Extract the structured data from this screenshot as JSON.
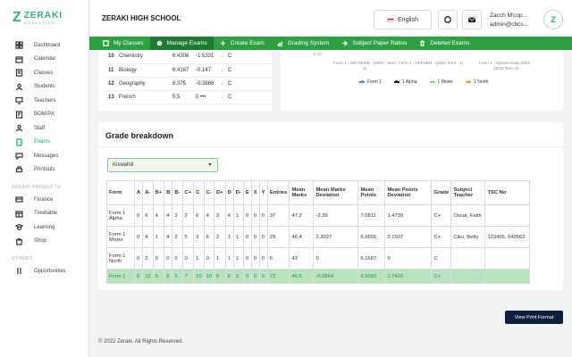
{
  "brand": {
    "name": "ZERAKI",
    "tagline": "ANALYTICS"
  },
  "sidebar": {
    "items": [
      {
        "label": "Dashboard",
        "icon": "dashboard-icon"
      },
      {
        "label": "Calendar",
        "icon": "calendar-icon"
      },
      {
        "label": "Classes",
        "icon": "classes-icon"
      },
      {
        "label": "Students",
        "icon": "students-icon"
      },
      {
        "label": "Teachers",
        "icon": "teachers-icon"
      },
      {
        "label": "BOM/PA",
        "icon": "bom-icon"
      },
      {
        "label": "Staff",
        "icon": "staff-icon"
      },
      {
        "label": "Exams",
        "icon": "exams-icon",
        "active": true
      },
      {
        "label": "Messages",
        "icon": "messages-icon"
      },
      {
        "label": "Printouts",
        "icon": "printouts-icon"
      }
    ],
    "products_heading": "ZERAKI PRODUCTS",
    "products": [
      {
        "label": "Finance",
        "icon": "finance-icon"
      },
      {
        "label": "Timetable",
        "icon": "timetable-icon"
      },
      {
        "label": "Learning",
        "icon": "learning-icon"
      },
      {
        "label": "Shop",
        "icon": "shop-icon"
      }
    ],
    "others_heading": "OTHERS",
    "others": [
      {
        "label": "Opportunities",
        "icon": "opportunities-icon"
      }
    ]
  },
  "header": {
    "school": "ZERAKI HIGH SCHOOL",
    "language": "English",
    "user_name": "Zacch M'cop...",
    "user_email": "admin@cbcs..."
  },
  "tabs": [
    {
      "label": "My Classes",
      "icon": "classes-tab-icon"
    },
    {
      "label": "Manage Exams",
      "icon": "gear-icon",
      "active": true
    },
    {
      "label": "Create Exam",
      "icon": "plus-icon"
    },
    {
      "label": "Grading System",
      "icon": "chart-icon"
    },
    {
      "label": "Subject Paper Ratios",
      "icon": "ratio-icon"
    },
    {
      "label": "Deleted Exams",
      "icon": "trash-icon"
    }
  ],
  "subjects": [
    {
      "no": "10",
      "name": "Chemistry",
      "mean": "6.4306",
      "dev": "-1.5331",
      "grade": "C"
    },
    {
      "no": "11",
      "name": "Biology",
      "mean": "6.4167",
      "dev": "-0.147",
      "grade": "C"
    },
    {
      "no": "12",
      "name": "Geography",
      "mean": "6.375",
      "dev": "-0.3886",
      "grade": "C"
    },
    {
      "no": "13",
      "name": "French",
      "mean": "5.5",
      "dev": "0 •••",
      "grade": "C"
    }
  ],
  "chart": {
    "tick": "6.25",
    "categories": [
      "Form 1 - MID TERM - (2022 - Term 1)",
      "Form 1 - OPENER - (2022 Term - 1)",
      "Form 1 - Opener exam 2022 - (2022 Term 1)"
    ],
    "legend": [
      {
        "name": "Form 1",
        "color": "#4a90e2"
      },
      {
        "name": "1 Alpha",
        "color": "#222222"
      },
      {
        "name": "1 Moxie",
        "color": "#8bdc8b"
      },
      {
        "name": "1 North",
        "color": "#f0a030"
      }
    ]
  },
  "grade_breakdown": {
    "title": "Grade breakdown",
    "selected_subject": "Kiswahili",
    "headers": [
      "Form",
      "A",
      "A-",
      "B+",
      "B",
      "B-",
      "C+",
      "C",
      "C-",
      "D+",
      "D",
      "D-",
      "E",
      "X",
      "Y",
      "Entries",
      "Mean Marks",
      "Mean Marks Deviation",
      "Mean Points",
      "Mean Points Deviation",
      "Grade",
      "Subject Teacher",
      "TSC No"
    ],
    "rows": [
      [
        "Form 1 Alpha",
        "0",
        "6",
        "4",
        "4",
        "3",
        "2",
        "6",
        "4",
        "3",
        "4",
        "1",
        "0",
        "0",
        "0",
        "37",
        "47.3",
        "-2.39",
        "7.0811",
        "1.4739",
        "C+",
        "Oscar, Faith",
        ""
      ],
      [
        "Form 1 Moxie",
        "0",
        "4",
        "1",
        "4",
        "2",
        "5",
        "3",
        "6",
        "2",
        "1",
        "1",
        "0",
        "0",
        "0",
        "29",
        "46.4",
        "2.3027",
        "6.9655",
        "2.1507",
        "C+",
        "Ciku, Betty",
        "123456, 649563"
      ],
      [
        "Form 1 North",
        "0",
        "2",
        "0",
        "0",
        "0",
        "0",
        "1",
        "0",
        "1",
        "1",
        "1",
        "0",
        "0",
        "0",
        "6",
        "43",
        "0",
        "6.1667",
        "0",
        "C",
        "",
        ""
      ],
      [
        "Form 1",
        "0",
        "12",
        "5",
        "8",
        "5",
        "7",
        "10",
        "10",
        "6",
        "6",
        "3",
        "0",
        "0",
        "0",
        "72",
        "46.6",
        "-0.0864",
        "6.9583",
        "1.7402",
        "C+",
        "",
        ""
      ]
    ]
  },
  "print_button": "View Print Format",
  "footer": "© 2022 Zeraki. All Rights Reserved."
}
